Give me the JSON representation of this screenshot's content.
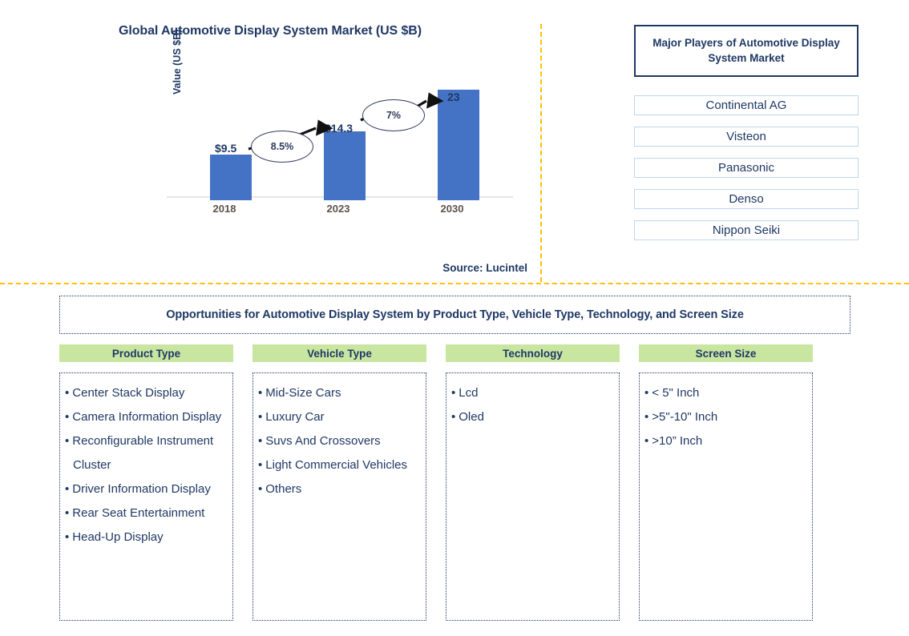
{
  "chart_data": {
    "type": "bar",
    "title": "Global Automotive Display System Market (US $B)",
    "xlabel": "",
    "ylabel": "Value (US $B)",
    "categories": [
      "2018",
      "2023",
      "2030"
    ],
    "values": [
      9.5,
      14.3,
      23
    ],
    "value_labels": [
      "$9.5",
      "$14.3",
      "23"
    ],
    "ylim": [
      0,
      25
    ],
    "grid": false,
    "legend": "none",
    "series": [
      {
        "name": "Value (US $B)",
        "values": [
          9.5,
          14.3,
          23
        ]
      }
    ],
    "annotations": [
      {
        "label": "8.5%",
        "from": "2018",
        "to": "2023",
        "kind": "cagr-bubble"
      },
      {
        "label": "7%",
        "from": "2023",
        "to": "2030",
        "kind": "cagr-bubble"
      }
    ],
    "bar_color": "#4472C4",
    "source": "Source: Lucintel"
  },
  "chart": {
    "title": "Global Automotive Display System Market (US $B)",
    "ylabel": "Value (US $B)",
    "source": "Source: Lucintel",
    "bars": [
      {
        "tick": "2018",
        "value_label": "$9.5"
      },
      {
        "tick": "2023",
        "value_label": "$14.3"
      },
      {
        "tick": "2030",
        "value_label": "23"
      }
    ],
    "cagr": [
      {
        "label": "8.5%"
      },
      {
        "label": "7%"
      }
    ]
  },
  "players": {
    "header": "Major Players of Automotive Display System Market",
    "items": [
      "Continental AG",
      "Visteon",
      "Panasonic",
      "Denso",
      "Nippon Seiki"
    ]
  },
  "opportunities": {
    "banner": "Opportunities for Automotive Display System by Product Type, Vehicle Type, Technology, and Screen Size",
    "columns": [
      {
        "header": "Product Type",
        "items": [
          "Center Stack Display",
          "Camera Information Display",
          "Reconfigurable Instrument Cluster",
          "Driver Information Display",
          "Rear Seat Entertainment",
          "Head-Up Display"
        ]
      },
      {
        "header": "Vehicle Type",
        "items": [
          "Mid-Size Cars",
          "Luxury Car",
          "Suvs And Crossovers",
          "Light Commercial Vehicles",
          "Others"
        ]
      },
      {
        "header": "Technology",
        "items": [
          "Lcd",
          "Oled"
        ]
      },
      {
        "header": "Screen Size",
        "items": [
          "< 5\" Inch",
          ">5\"-10\" Inch",
          ">10” Inch"
        ]
      }
    ]
  },
  "colors": {
    "brand_navy": "#1F3864",
    "bar_blue": "#4472C4",
    "divider_amber": "#FFC000",
    "header_green": "#C9E6A1",
    "player_border": "#BDD7EE"
  }
}
